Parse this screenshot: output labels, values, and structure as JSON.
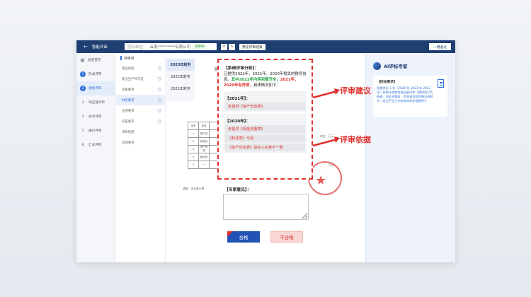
{
  "topbar": {
    "back_icon": "back-arrow-icon",
    "title": "智能评审",
    "unit_label": "招标单位：",
    "unit_value": "云南*********有限公司",
    "unit_badge": "评审中",
    "prev_label": "<",
    "next_label": ">",
    "results_label": "预览评审结果",
    "submit_label": "一键通过"
  },
  "nav": {
    "home": "返回首页",
    "items": [
      {
        "num": "1",
        "label": "形式评审"
      },
      {
        "num": "2",
        "label": "资格评审"
      },
      {
        "num": "3",
        "label": "响应性评审"
      },
      {
        "num": "4",
        "label": "技术评审"
      },
      {
        "num": "5",
        "label": "报价评审"
      },
      {
        "num": "6",
        "label": "汇总评审"
      }
    ]
  },
  "sub": {
    "header": "评审项",
    "items": [
      "营业执照",
      "安全生产许可证",
      "资质要求",
      "财务要求",
      "业绩要求",
      "信誉要求",
      "项目经理",
      "其他要求"
    ]
  },
  "years": [
    "2023年财务",
    "2022年财务",
    "2021年财务"
  ],
  "doc": {
    "head": "财",
    "table": [
      [
        "序号",
        "项目",
        "",
        "",
        "",
        "备注"
      ],
      [
        "1",
        "资产合",
        "",
        "",
        "",
        ""
      ],
      [
        "2",
        "负债合",
        "",
        "",
        "",
        ""
      ],
      [
        "3",
        "资产负债",
        "",
        "",
        "",
        ""
      ],
      [
        "4",
        "营业收",
        "",
        "",
        "",
        ""
      ],
      [
        "5",
        "一",
        "",
        "",
        "",
        ""
      ]
    ],
    "side_notes": [
      "单位：万元",
      "万元"
    ],
    "note": "填制：企业盖公章"
  },
  "popup": {
    "title": "【系统评审分析】：",
    "intro": "已提供2022年、2021年、2020年相关的财务信息。",
    "green_text": "其中2022年内容完整齐全",
    "comma": "，",
    "red_text": "2021年、2020年有异常",
    "tail": "，具体情况如下：",
    "y2021": "【2021年】：",
    "y2021_items": [
      "未提供《资产负债表》"
    ],
    "y2020": "【2020年】：",
    "y2020_items": [
      "未提供《现金流量表》",
      "《利润表》亏损",
      "《资产负债表》投标人名称不一致"
    ]
  },
  "opinion_label": "【专家意见】：",
  "buttons": {
    "pass": "合格",
    "fail": "不合格"
  },
  "ai": {
    "name": "AI评标专家",
    "card_title": "【招标要求】",
    "card_text": "须提供近 3 年（2020 年 2021 年 2022 年）经审计的财务报告复印件（提供资产负债表、现金流量表、利润表及财务情况说明书（成立不足三年的按实际年限提供））"
  },
  "annotations": {
    "suggestion": "评审建议",
    "basis": "评审依据"
  },
  "colors": {
    "accent": "#1f3f73",
    "alert": "#e0302e",
    "ok": "#2aa748"
  }
}
